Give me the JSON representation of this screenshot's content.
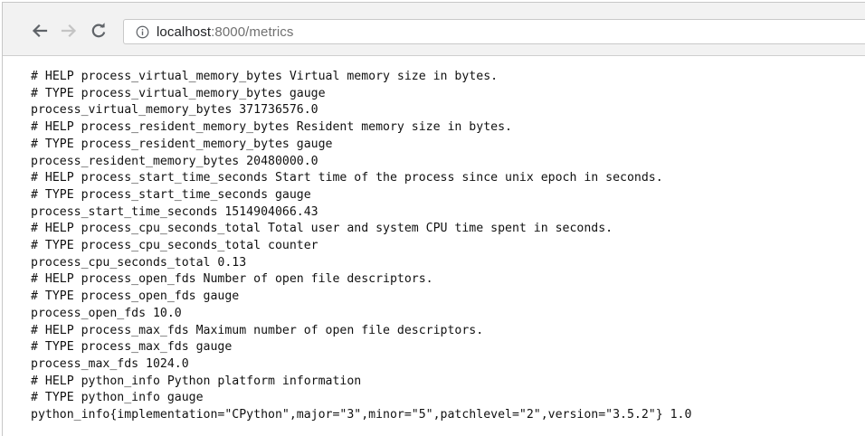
{
  "browser": {
    "url": {
      "host": "localhost",
      "rest": ":8000/metrics"
    },
    "icons": {
      "back": "back-arrow-icon",
      "forward": "forward-arrow-icon",
      "reload": "reload-icon",
      "info": "info-icon"
    }
  },
  "page": {
    "lines": [
      "# HELP process_virtual_memory_bytes Virtual memory size in bytes.",
      "# TYPE process_virtual_memory_bytes gauge",
      "process_virtual_memory_bytes 371736576.0",
      "# HELP process_resident_memory_bytes Resident memory size in bytes.",
      "# TYPE process_resident_memory_bytes gauge",
      "process_resident_memory_bytes 20480000.0",
      "# HELP process_start_time_seconds Start time of the process since unix epoch in seconds.",
      "# TYPE process_start_time_seconds gauge",
      "process_start_time_seconds 1514904066.43",
      "# HELP process_cpu_seconds_total Total user and system CPU time spent in seconds.",
      "# TYPE process_cpu_seconds_total counter",
      "process_cpu_seconds_total 0.13",
      "# HELP process_open_fds Number of open file descriptors.",
      "# TYPE process_open_fds gauge",
      "process_open_fds 10.0",
      "# HELP process_max_fds Maximum number of open file descriptors.",
      "# TYPE process_max_fds gauge",
      "process_max_fds 1024.0",
      "# HELP python_info Python platform information",
      "# TYPE python_info gauge",
      "python_info{implementation=\"CPython\",major=\"3\",minor=\"5\",patchlevel=\"2\",version=\"3.5.2\"} 1.0"
    ]
  }
}
